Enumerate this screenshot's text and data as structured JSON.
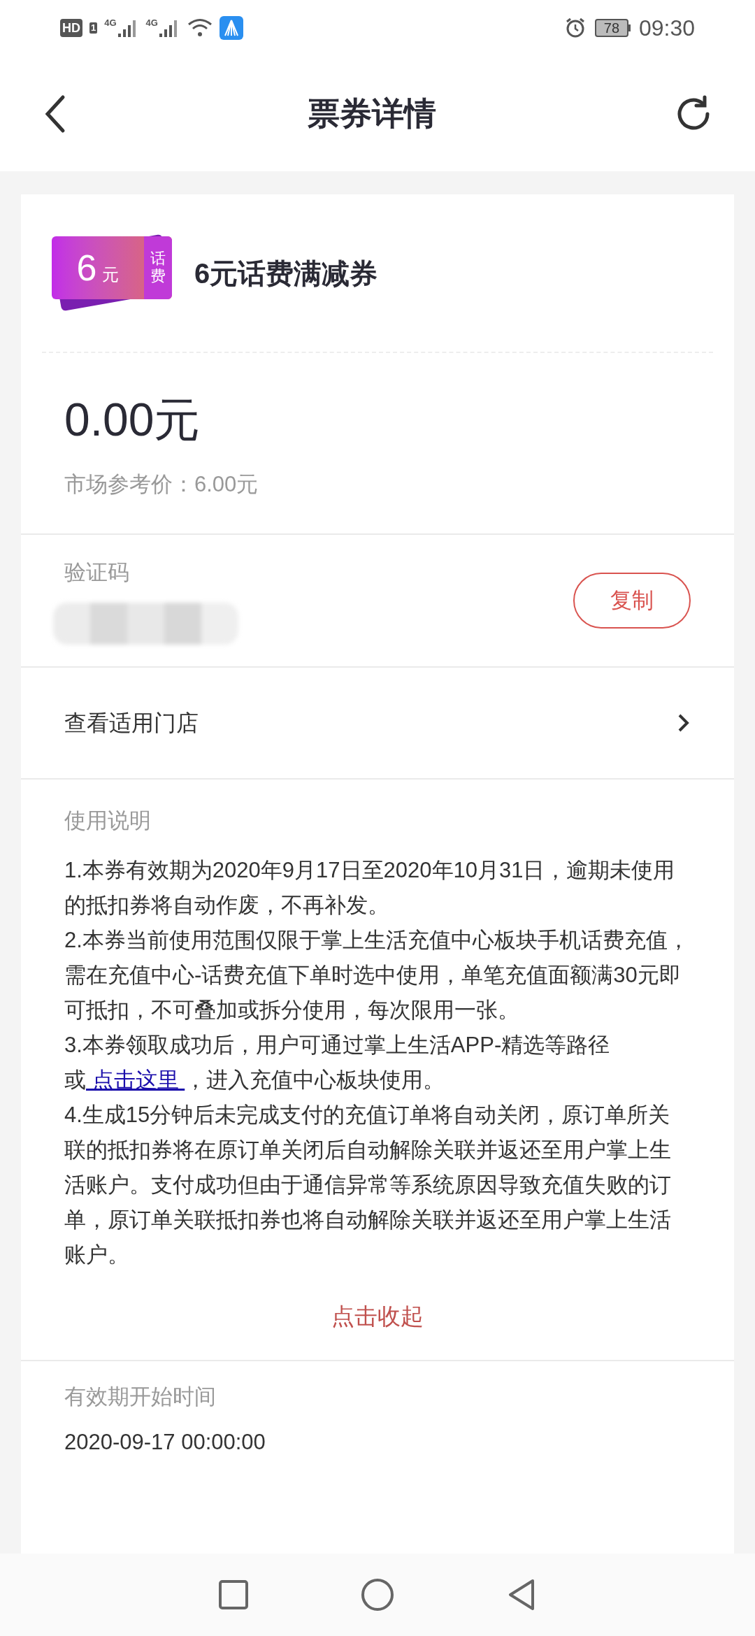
{
  "status_bar": {
    "hd": "HD",
    "sim": "1",
    "net1": "4G",
    "net2": "4G",
    "battery": "78",
    "time": "09:30"
  },
  "header": {
    "title": "票券详情"
  },
  "coupon": {
    "badge_amount": "6",
    "badge_unit": "元",
    "badge_tag": "话费",
    "title": "6元话费满减券"
  },
  "price": {
    "value": "0.00元",
    "market": "市场参考价：6.00元"
  },
  "code": {
    "label": "验证码",
    "copy_button": "复制"
  },
  "stores": {
    "label": "查看适用门店"
  },
  "instructions": {
    "title": "使用说明",
    "paragraphs": [
      {
        "kind": "text",
        "text": "1.本券有效期为2020年9月17日至2020年10月31日，逾期未使用的抵扣券将自动作废，不再补发。"
      },
      {
        "kind": "text",
        "text": "2.本券当前使用范围仅限于掌上生活充值中心板块手机话费充值，需在充值中心-话费充值下单时选中使用，单笔充值面额满30元即可抵扣，不可叠加或拆分使用，每次限用一张。"
      },
      {
        "kind": "link",
        "before": "3.本券领取成功后，用户可通过掌上生活APP-精选等路径或",
        "link": " 点击这里 ",
        "after": "，进入充值中心板块使用。"
      },
      {
        "kind": "text",
        "text": "4.生成15分钟后未完成支付的充值订单将自动关闭，原订单所关联的抵扣券将在原订单关闭后自动解除关联并返还至用户掌上生活账户。支付成功但由于通信异常等系统原因导致充值失败的订单，原订单关联抵扣券也将自动解除关联并返还至用户掌上生活账户。"
      }
    ],
    "collapse": "点击收起"
  },
  "validity": {
    "label": "有效期开始时间",
    "value": "2020-09-17 00:00:00"
  }
}
